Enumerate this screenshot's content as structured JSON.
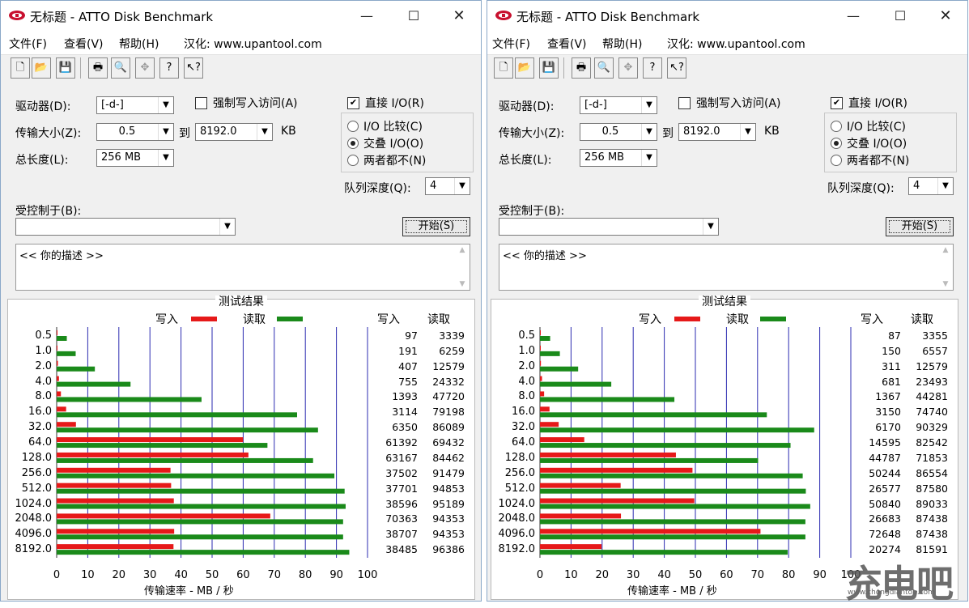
{
  "windows": [
    {
      "title": "无标题 - ATTO Disk Benchmark",
      "menu": [
        "文件(F)",
        "查看(V)",
        "帮助(H)",
        "汉化: www.upantool.com"
      ],
      "form": {
        "drive_label": "驱动器(D):",
        "drive_value": "[-d-]",
        "force_write_label": "强制写入访问(A)",
        "force_write_checked": false,
        "direct_io_label": "直接 I/O(R)",
        "direct_io_checked": true,
        "transfer_label": "传输大小(Z):",
        "transfer_from": "0.5",
        "to_label": "到",
        "transfer_to": "8192.0",
        "unit": "KB",
        "length_label": "总长度(L):",
        "length_value": "256 MB",
        "radio_compare": "I/O 比较(C)",
        "radio_overlap": "交叠 I/O(O)",
        "radio_neither": "两者都不(N)",
        "selected_radio": "overlap",
        "queue_label": "队列深度(Q):",
        "queue_value": "4",
        "controlled_label": "受控制于(B):",
        "controlled_value": "",
        "start_button": "开始(S)",
        "description": "<< 你的描述 >>"
      },
      "results": {
        "title": "测试结果",
        "legend_write": "写入",
        "legend_read": "读取",
        "col_write": "写入",
        "col_read": "读取",
        "xlabel": "传输速率 - MB / 秒"
      },
      "chart_data": {
        "type": "bar",
        "categories": [
          "0.5",
          "1.0",
          "2.0",
          "4.0",
          "8.0",
          "16.0",
          "32.0",
          "64.0",
          "128.0",
          "256.0",
          "512.0",
          "1024.0",
          "2048.0",
          "4096.0",
          "8192.0"
        ],
        "series": [
          {
            "name": "写入",
            "color": "#e61919",
            "values": [
              97,
              191,
              407,
              755,
              1393,
              3114,
              6350,
              61392,
              63167,
              37502,
              37701,
              38596,
              70363,
              38707,
              38485
            ]
          },
          {
            "name": "读取",
            "color": "#1a8a1a",
            "values": [
              3339,
              6259,
              12579,
              24332,
              47720,
              79198,
              86089,
              69432,
              84462,
              91479,
              94853,
              95189,
              94353,
              94353,
              96386
            ]
          }
        ],
        "xlim": [
          0,
          100
        ],
        "xticks": [
          "0",
          "10",
          "20",
          "30",
          "40",
          "50",
          "60",
          "70",
          "80",
          "90",
          "100"
        ],
        "xlabel": "传输速率 - MB / 秒",
        "grid": true,
        "legend": "top"
      }
    },
    {
      "title": "无标题 - ATTO Disk Benchmark",
      "menu": [
        "文件(F)",
        "查看(V)",
        "帮助(H)",
        "汉化: www.upantool.com"
      ],
      "form": {
        "drive_label": "驱动器(D):",
        "drive_value": "[-d-]",
        "force_write_label": "强制写入访问(A)",
        "force_write_checked": false,
        "direct_io_label": "直接 I/O(R)",
        "direct_io_checked": true,
        "transfer_label": "传输大小(Z):",
        "transfer_from": "0.5",
        "to_label": "到",
        "transfer_to": "8192.0",
        "unit": "KB",
        "length_label": "总长度(L):",
        "length_value": "256 MB",
        "radio_compare": "I/O 比较(C)",
        "radio_overlap": "交叠 I/O(O)",
        "radio_neither": "两者都不(N)",
        "selected_radio": "overlap",
        "queue_label": "队列深度(Q):",
        "queue_value": "4",
        "controlled_label": "受控制于(B):",
        "controlled_value": "",
        "start_button": "开始(S)",
        "description": "<< 你的描述 >>"
      },
      "results": {
        "title": "测试结果",
        "legend_write": "写入",
        "legend_read": "读取",
        "col_write": "写入",
        "col_read": "读取",
        "xlabel": "传输速率 - MB / 秒"
      },
      "chart_data": {
        "type": "bar",
        "categories": [
          "0.5",
          "1.0",
          "2.0",
          "4.0",
          "8.0",
          "16.0",
          "32.0",
          "64.0",
          "128.0",
          "256.0",
          "512.0",
          "1024.0",
          "2048.0",
          "4096.0",
          "8192.0"
        ],
        "series": [
          {
            "name": "写入",
            "color": "#e61919",
            "values": [
              87,
              150,
              311,
              681,
              1367,
              3150,
              6170,
              14595,
              44787,
              50244,
              26577,
              50840,
              26683,
              72648,
              20274
            ]
          },
          {
            "name": "读取",
            "color": "#1a8a1a",
            "values": [
              3355,
              6557,
              12579,
              23493,
              44281,
              74740,
              90329,
              82542,
              71853,
              86554,
              87580,
              89033,
              87438,
              87438,
              81591
            ]
          }
        ],
        "xlim": [
          0,
          100
        ],
        "xticks": [
          "0",
          "10",
          "20",
          "30",
          "40",
          "50",
          "60",
          "70",
          "80",
          "90",
          "100"
        ],
        "xlabel": "传输速率 - MB / 秒",
        "grid": true,
        "legend": "top"
      }
    }
  ],
  "watermark": {
    "main": "充电吧",
    "sub": "www.chongdiantou.com"
  }
}
